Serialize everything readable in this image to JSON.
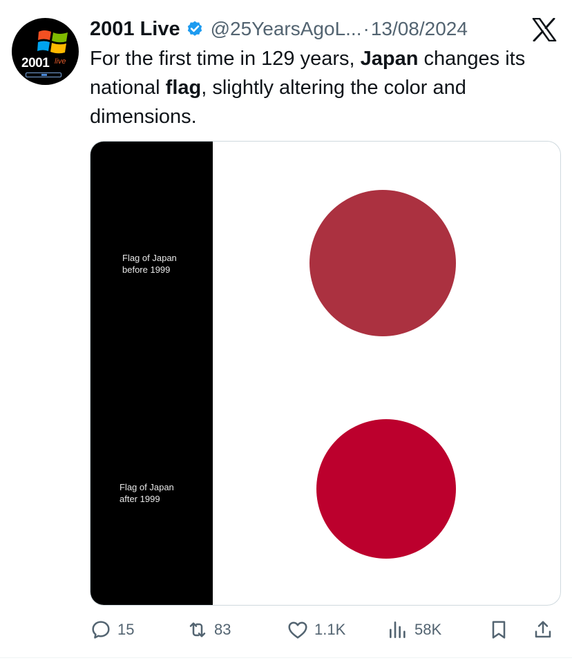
{
  "tweet": {
    "avatar": {
      "text": "2001",
      "superscript": "live"
    },
    "display_name": "2001 Live",
    "handle": "@25YearsAgoL...",
    "separator": "·",
    "date": "13/08/2024",
    "text_parts": [
      "For the first time in 129 years, ",
      "Japan",
      " changes its national ",
      "flag",
      ", slightly altering the color and dimensions."
    ],
    "image": {
      "caption_before_line1": "Flag of Japan",
      "caption_before_line2": "before 1999",
      "caption_after_line1": "Flag of Japan",
      "caption_after_line2": "after 1999",
      "circle_before_color": "#ab3140",
      "circle_after_color": "#bc002d"
    },
    "stats": {
      "replies": "15",
      "reposts": "83",
      "likes": "1.1K",
      "views": "58K"
    },
    "colors": {
      "verified": "#1d9bf0",
      "secondary_text": "#536471"
    }
  }
}
